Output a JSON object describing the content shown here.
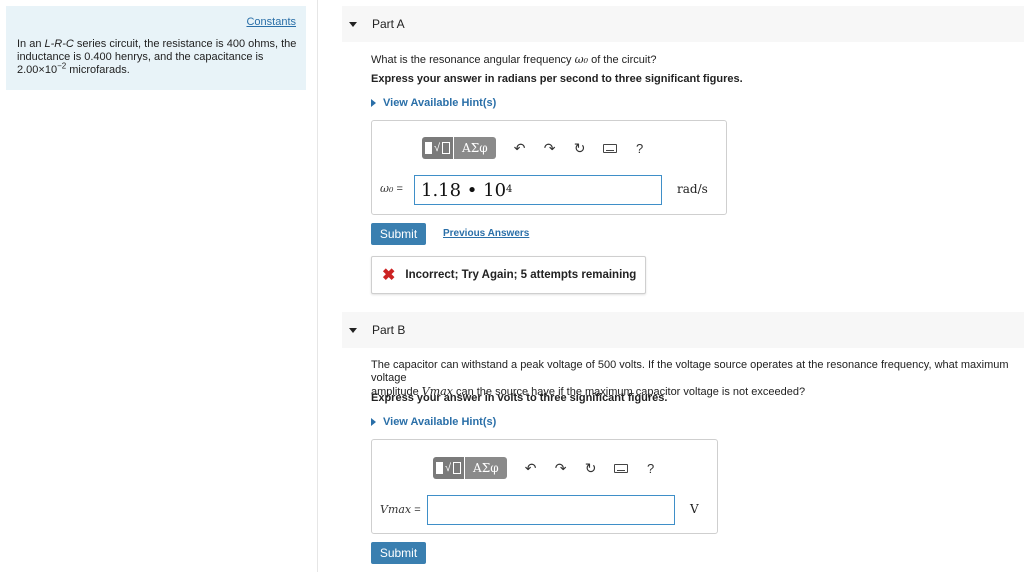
{
  "left_panel": {
    "constants_link": "Constants",
    "problem_line1_prefix": "In an ",
    "problem_circuit": "L-R-C",
    "problem_line1_suffix": " series circuit, the resistance is 400 ohms, the",
    "problem_line2": "inductance is 0.400 henrys, and the capacitance is",
    "problem_cap_mantissa": "2.00×10",
    "problem_cap_exp": "−2",
    "problem_cap_unit": " microfarads."
  },
  "part_a": {
    "title": "Part A",
    "question_prefix": "What is the resonance angular frequency ",
    "question_symbol": "ω₀",
    "question_suffix": " of the circuit?",
    "instruction": "Express your answer in radians per second to three significant figures.",
    "hint_link": "View Available Hint(s)",
    "toolbar": {
      "greek": "ΑΣφ",
      "help": "?"
    },
    "var_label": "ω₀",
    "equals": " =",
    "answer_mantissa": "1.18 • 10",
    "answer_exp": "4",
    "unit": "rad/s",
    "submit_label": "Submit",
    "previous_answers": "Previous Answers",
    "feedback": "Incorrect; Try Again; 5 attempts remaining"
  },
  "part_b": {
    "title": "Part B",
    "question_line1": "The capacitor can withstand a peak voltage of 500 volts. If the voltage source operates at the resonance frequency, what maximum voltage",
    "question_line2_prefix": "amplitude ",
    "question_symbol": "Vmax",
    "question_line2_suffix": " can the source have if the maximum capacitor voltage is not exceeded?",
    "instruction": "Express your answer in volts to three significant figures.",
    "hint_link": "View Available Hint(s)",
    "toolbar": {
      "greek": "ΑΣφ",
      "help": "?"
    },
    "var_label": "Vmax",
    "equals": " =",
    "answer_value": "",
    "unit": "V",
    "submit_label": "Submit"
  },
  "colors": {
    "accent": "#3a7fb0",
    "link": "#2a6fa8",
    "left_panel_bg": "#e8f3f8",
    "error": "#cc2222"
  },
  "icons": [
    "templates-icon",
    "greek-icon",
    "undo-icon",
    "redo-icon",
    "reset-icon",
    "keyboard-icon",
    "help-icon",
    "incorrect-x-icon"
  ]
}
